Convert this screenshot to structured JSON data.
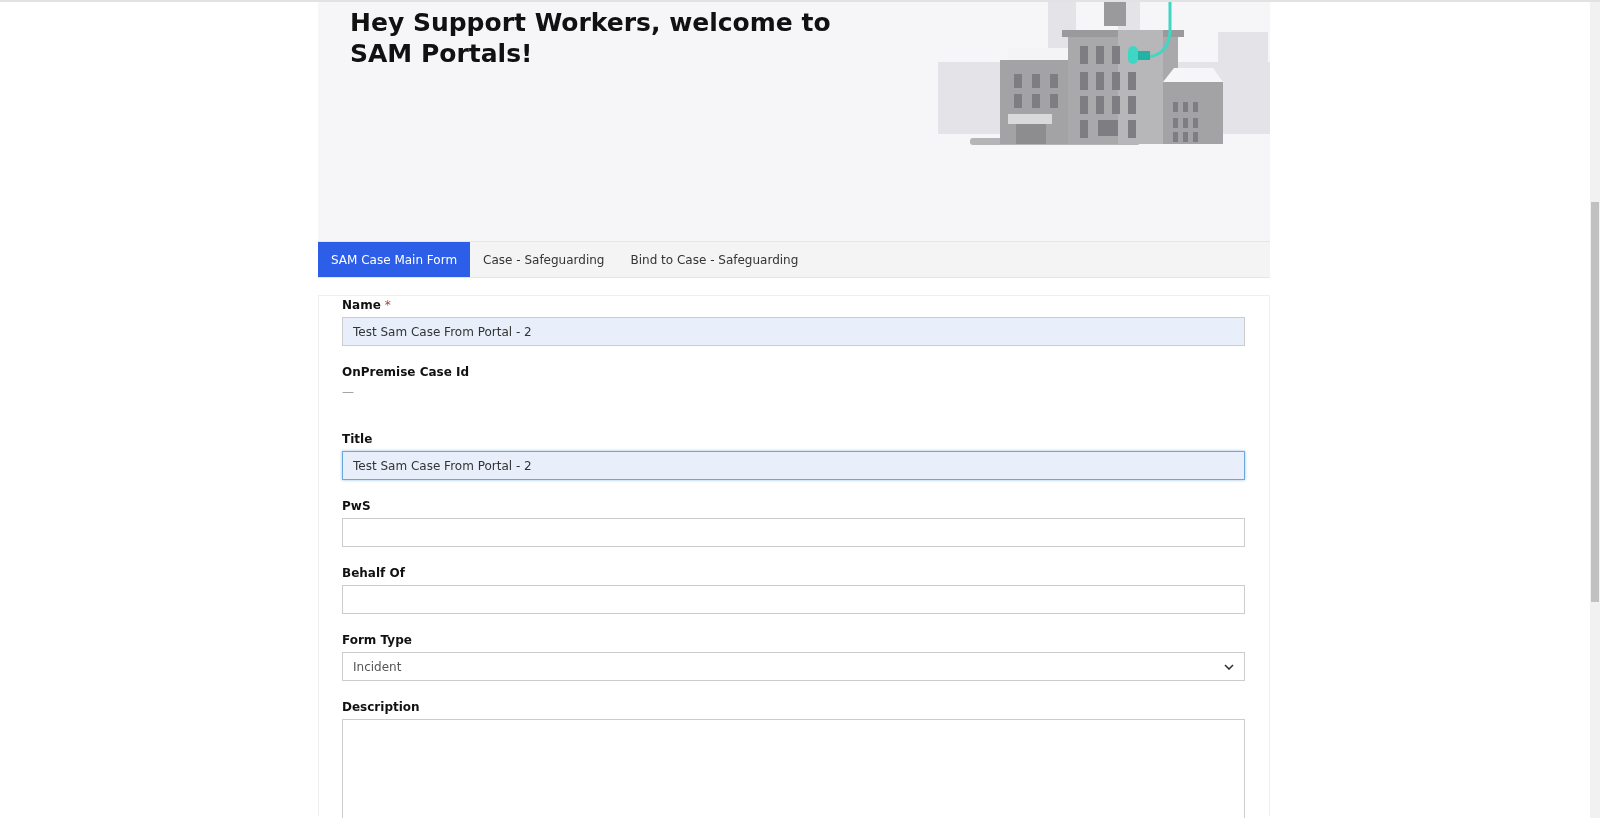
{
  "hero": {
    "title": "Hey Support Workers, welcome to SAM Portals!"
  },
  "tabs": [
    {
      "label": "SAM Case Main Form",
      "selected": true
    },
    {
      "label": "Case - Safeguarding",
      "selected": false
    },
    {
      "label": "Bind to Case - Safeguarding",
      "selected": false
    }
  ],
  "form": {
    "fields": [
      {
        "kind": "text",
        "label": "Name",
        "required_mark": "*",
        "value": "Test Sam Case From Portal - 2",
        "focused": false
      },
      {
        "kind": "readonly",
        "label": "OnPremise Case Id",
        "value": "—"
      },
      {
        "kind": "text",
        "label": "Title",
        "value": "Test Sam Case From Portal - 2",
        "focused": true
      },
      {
        "kind": "text",
        "label": "PwS",
        "focused": false
      },
      {
        "kind": "text",
        "label": "Behalf Of",
        "focused": false
      },
      {
        "kind": "select",
        "label": "Form Type",
        "value": "Incident"
      },
      {
        "kind": "textarea",
        "label": "Description"
      }
    ]
  }
}
